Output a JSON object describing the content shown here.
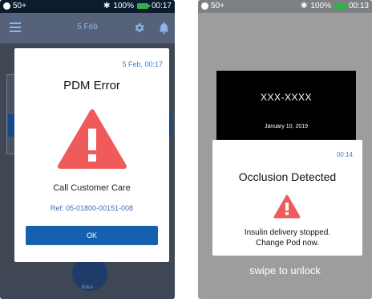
{
  "left_screen": {
    "status_bar": {
      "signal": "50+",
      "battery": "100%",
      "time": "00:17"
    },
    "header": {
      "title": "5 Feb"
    },
    "background": {
      "bolus_label": "Bolus"
    },
    "dialog": {
      "timestamp": "5 Feb, 00:17",
      "title": "PDM Error",
      "message": "Call Customer Care",
      "reference": "Ref: 05-01800-00151-008",
      "ok_label": "OK"
    }
  },
  "right_screen": {
    "status_bar": {
      "signal": "50+",
      "battery": "100%",
      "time": "00:13"
    },
    "lock": {
      "number": "XXX-XXXX",
      "date": "January 10, 2019"
    },
    "notification": {
      "time": "00:14",
      "title": "Occlusion Detected",
      "line1": "Insulin delivery stopped.",
      "line2": "Change Pod now."
    },
    "swipe_text": "swipe to unlock"
  },
  "colors": {
    "alert_red": "#ef5a5a",
    "primary_blue": "#1561b0",
    "link_blue": "#3f80d6",
    "battery_green": "#2db34a"
  },
  "icons": {
    "signal": "signal-icon",
    "bluetooth": "bluetooth-icon",
    "battery": "battery-icon",
    "menu": "menu-icon",
    "settings": "gear-icon",
    "notifications": "bell-icon",
    "warning": "warning-icon"
  }
}
